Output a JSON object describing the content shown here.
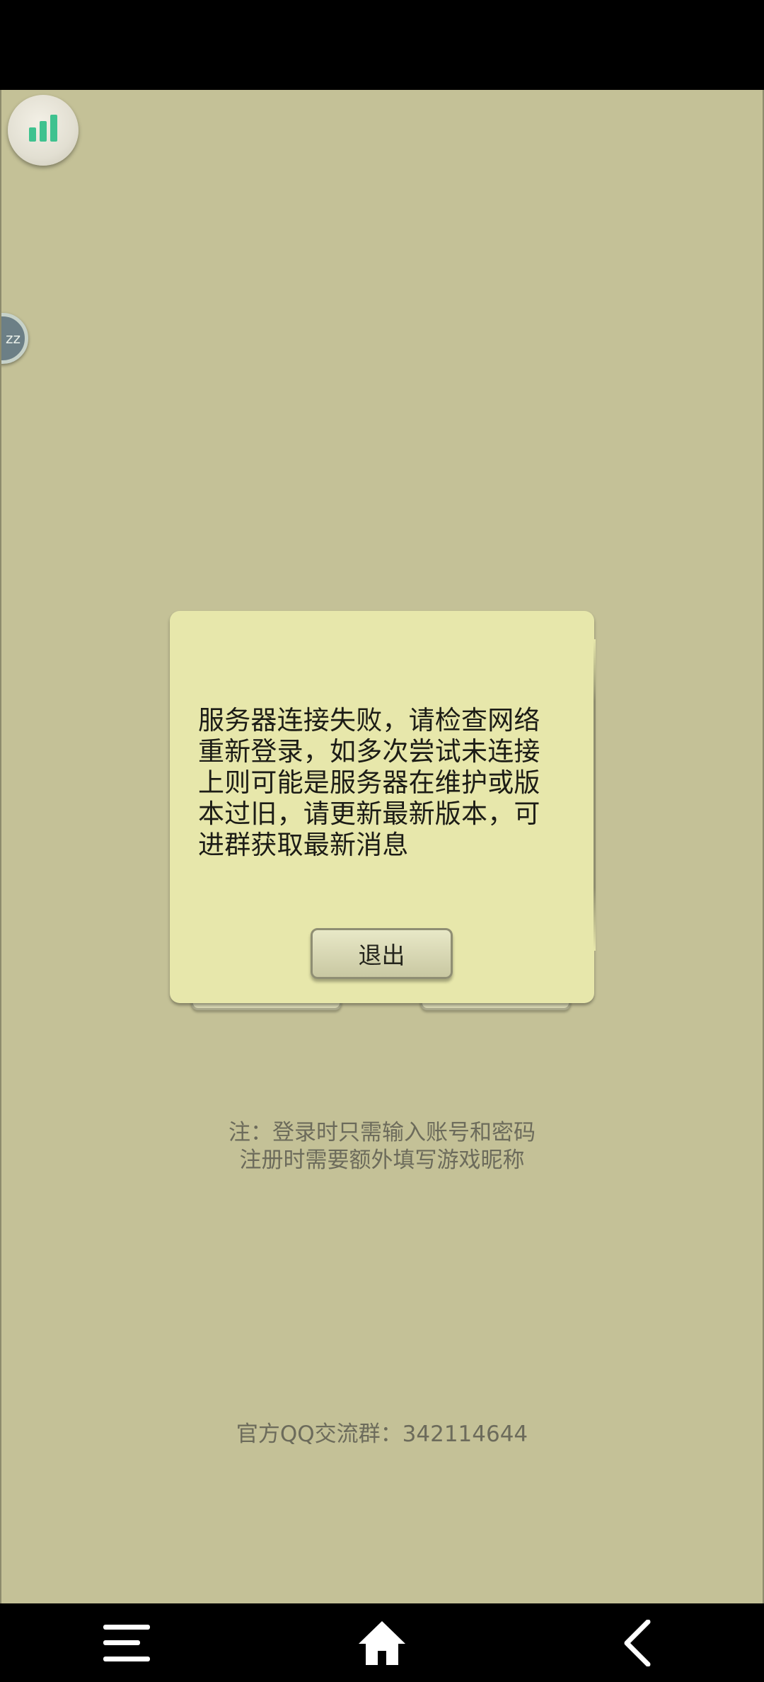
{
  "dialog": {
    "message": "服务器连接失败，请检查网络重新登录，如多次尝试未连接上则可能是服务器在维护或版本过旧，请更新最新版本，可进群获取最新消息",
    "exit_label": "退出"
  },
  "note": {
    "line1": "注：登录时只需输入账号和密码",
    "line2": "注册时需要额外填写游戏昵称"
  },
  "qq_group": "官方QQ交流群：342114644",
  "side_float_label": "zz",
  "icons": {
    "stats": "bar-chart-icon",
    "menu": "menu-icon",
    "home": "home-icon",
    "back": "back-icon"
  },
  "colors": {
    "background": "#c4c197",
    "dialog": "#e7e7ab",
    "stats_bars": "#3fc28f"
  }
}
